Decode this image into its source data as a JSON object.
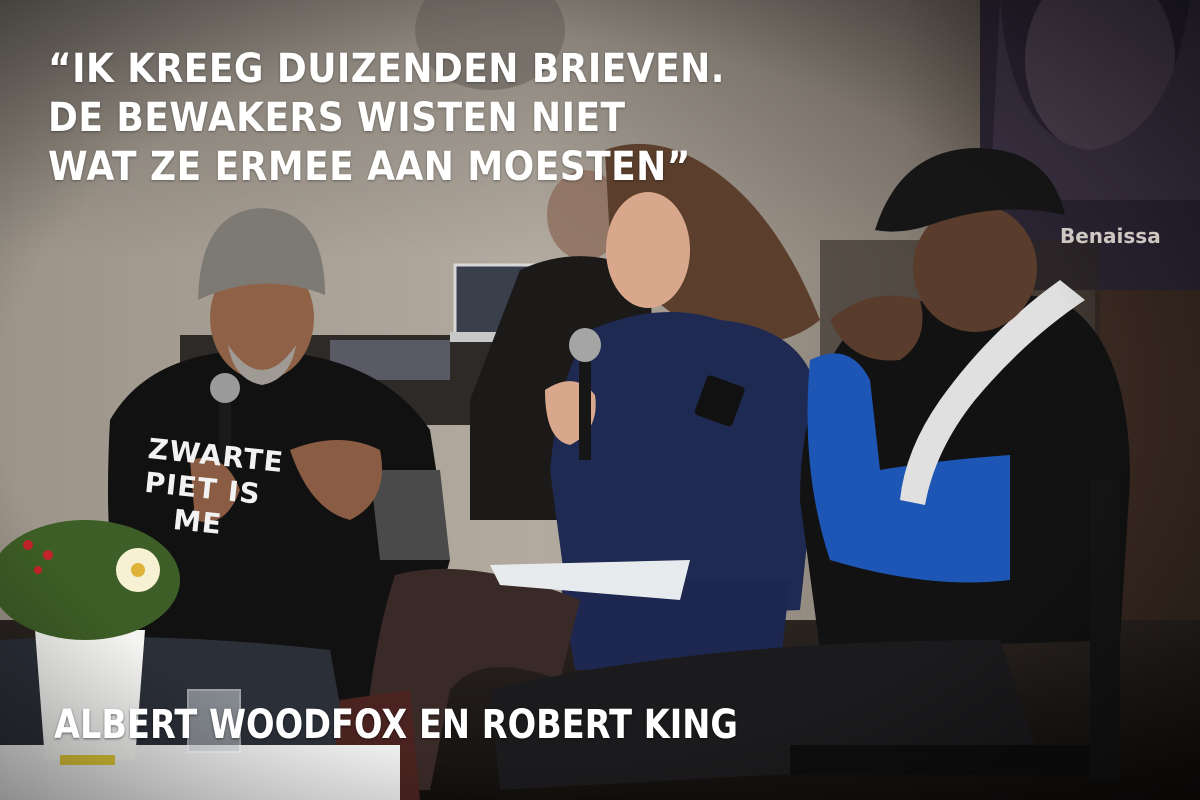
{
  "quote": {
    "line1": "“IK KREEG DUIZENDEN BRIEVEN.",
    "line2": "DE BEWAKERS WISTEN NIET",
    "line3": "WAT ZE ERMEE AAN MOESTEN”"
  },
  "caption": "ALBERT WOODFOX EN ROBERT KING",
  "poster_text": "Benaissa",
  "shirt_text": "ZWARTE\nPIET IS\n   ME"
}
